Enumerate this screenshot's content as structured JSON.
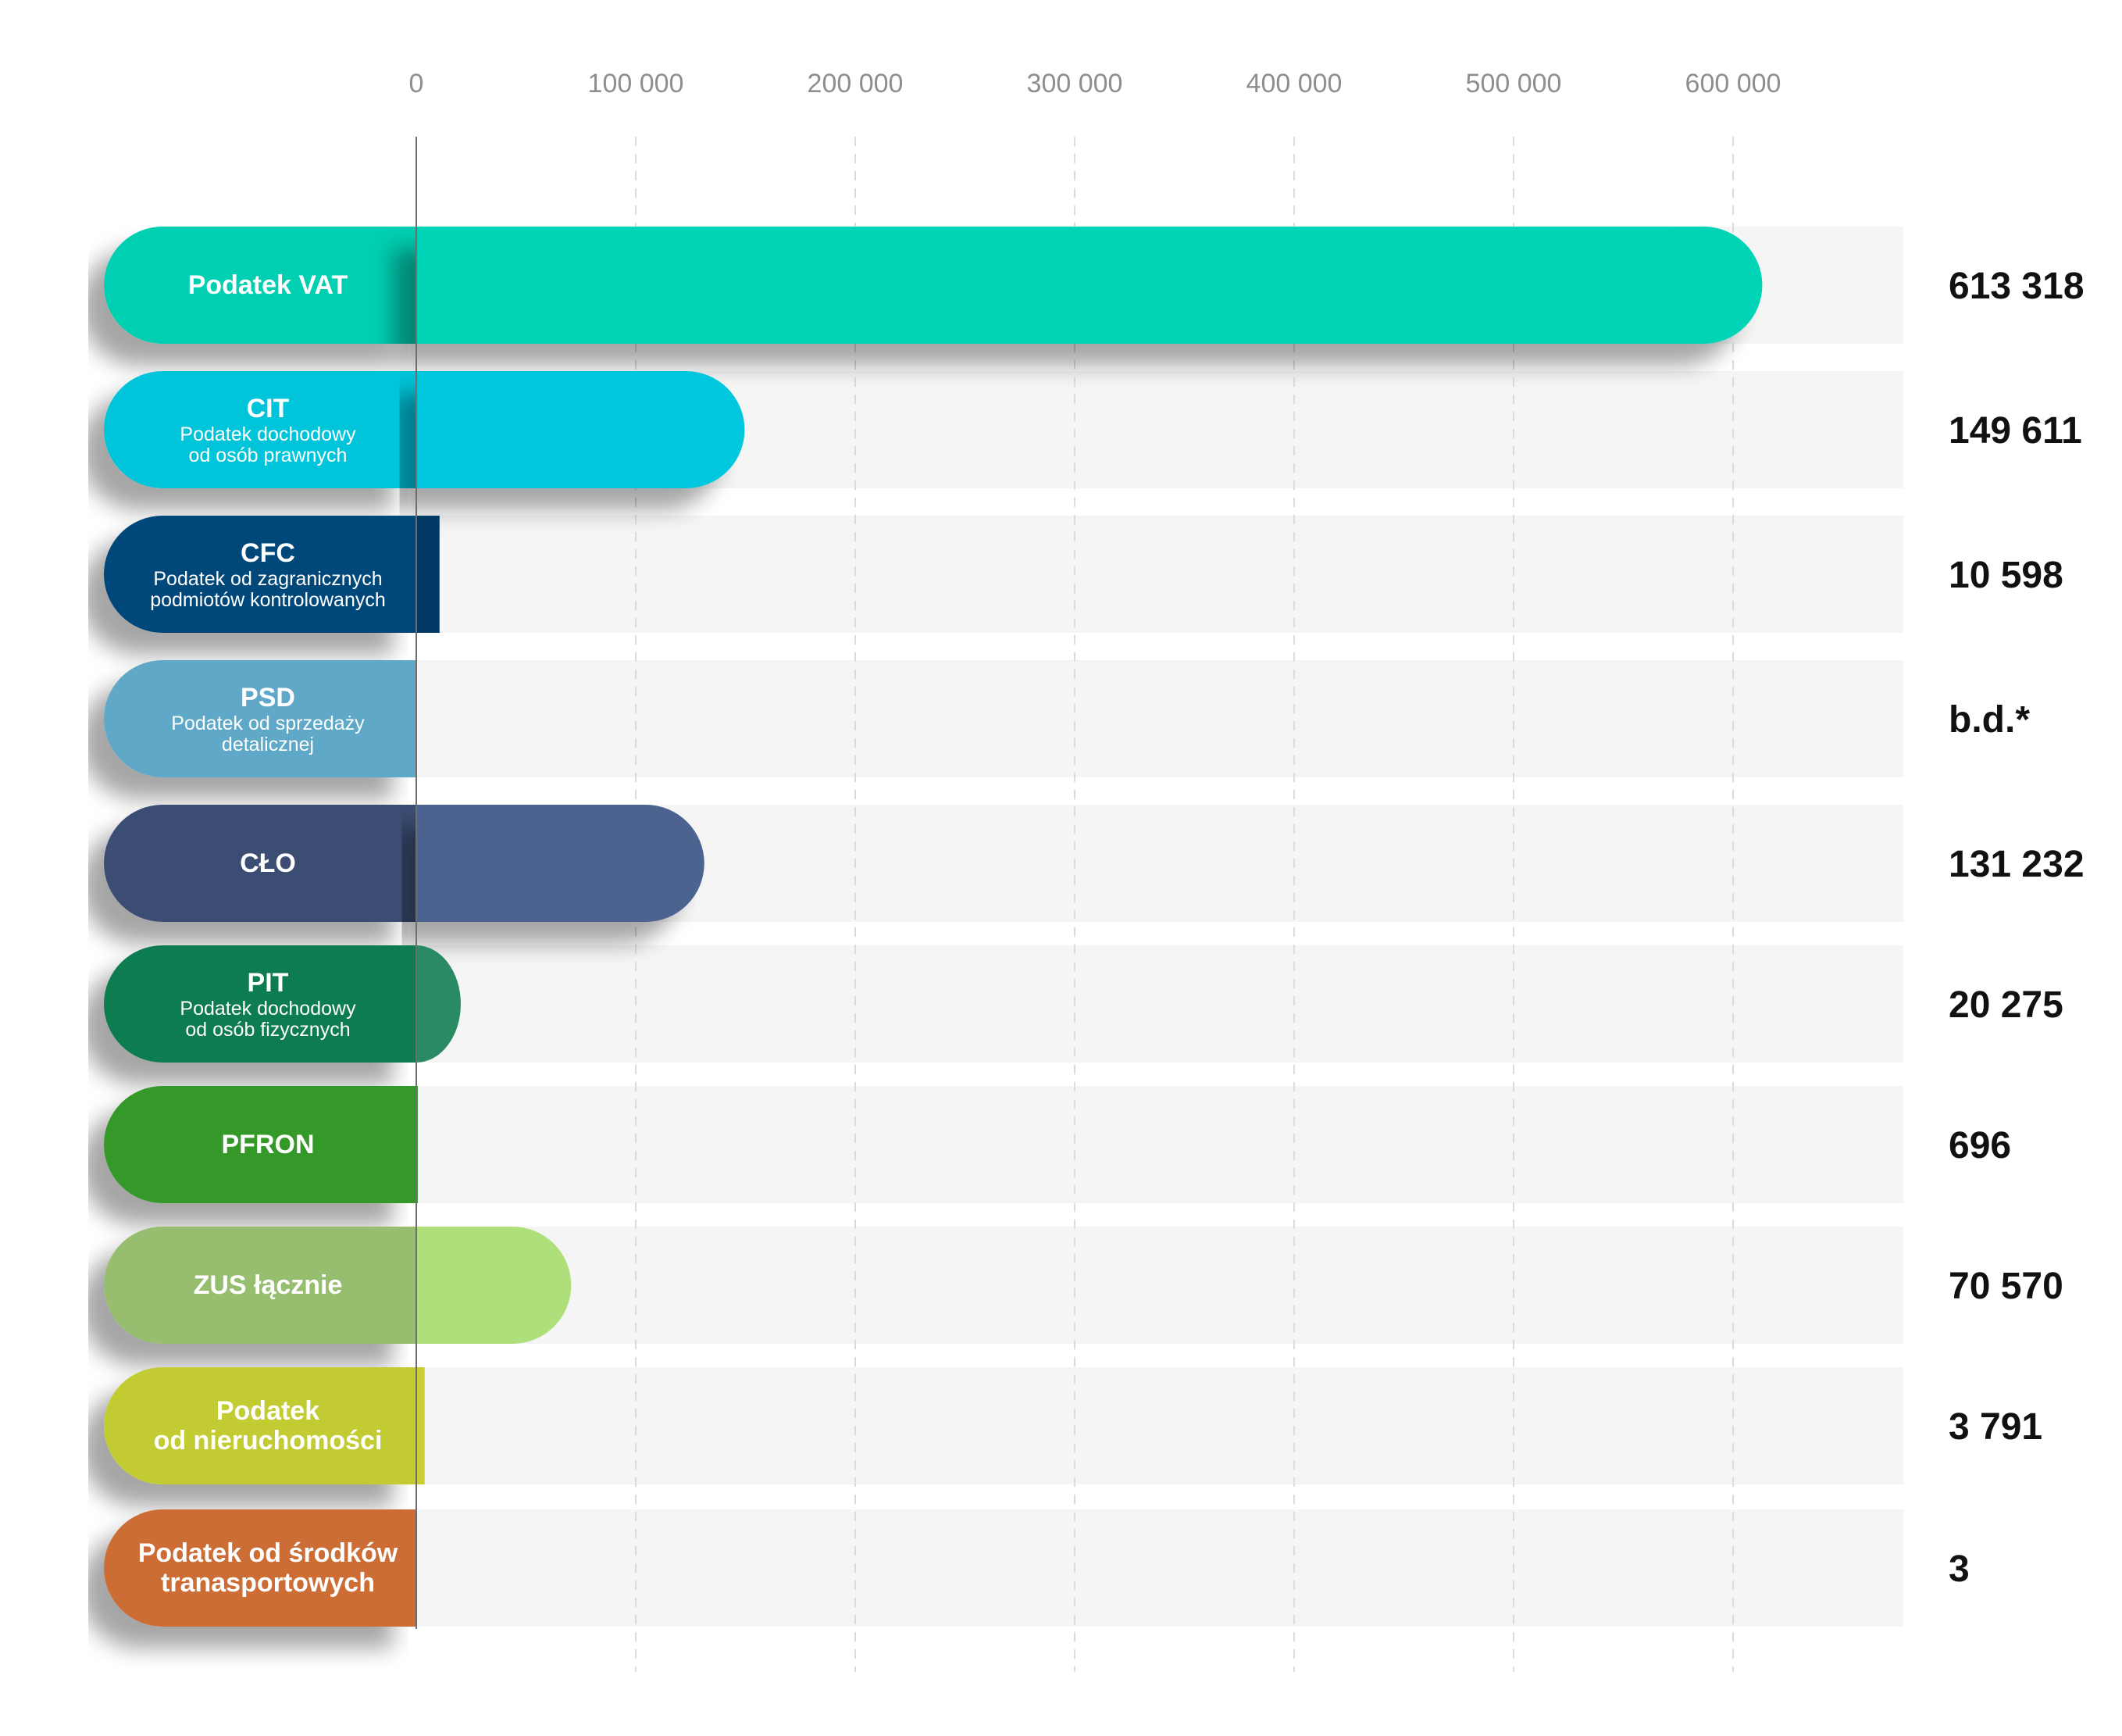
{
  "chart_data": {
    "type": "bar",
    "orientation": "horizontal",
    "xlim": [
      0,
      700000
    ],
    "x_ticks": [
      0,
      100000,
      200000,
      300000,
      400000,
      500000,
      600000
    ],
    "x_tick_labels": [
      "0",
      "100 000",
      "200 000",
      "300 000",
      "400 000",
      "500 000",
      "600 000"
    ],
    "grid": "vertical-dashed",
    "categories": [
      {
        "title": "Podatek VAT",
        "subtitle": [],
        "value": 613318,
        "value_label": "613 318",
        "color": "#00d4b6",
        "left_color": "#00cfb2"
      },
      {
        "title": "CIT",
        "subtitle": [
          "Podatek dochodowy",
          "od osób prawnych"
        ],
        "value": 149611,
        "value_label": "149 611",
        "color": "#00c7dd",
        "left_color": "#00c4da"
      },
      {
        "title": "CFC",
        "subtitle": [
          "Podatek od zagranicznych",
          "podmiotów kontrolowanych"
        ],
        "value": 10598,
        "value_label": "10 598",
        "color": "#023a66",
        "left_color": "#03467a"
      },
      {
        "title": "PSD",
        "subtitle": [
          "Podatek od sprzedaży",
          "detalicznej"
        ],
        "value": null,
        "value_label": "b.d.*",
        "color": "#5ea8c7",
        "left_color": "#5ea8c7"
      },
      {
        "title": "CŁO",
        "subtitle": [],
        "value": 131232,
        "value_label": "131 232",
        "color": "#4b638e",
        "left_color": "#3a4d73"
      },
      {
        "title": "PIT",
        "subtitle": [
          "Podatek dochodowy",
          "od osób fizycznych"
        ],
        "value": 20275,
        "value_label": "20 275",
        "color": "#2a8a64",
        "left_color": "#0b7c51"
      },
      {
        "title": "PFRON",
        "subtitle": [],
        "value": 696,
        "value_label": "696",
        "color": "#2e9a2c",
        "left_color": "#35992b"
      },
      {
        "title": "ZUS łącznie",
        "subtitle": [],
        "value": 70570,
        "value_label": "70 570",
        "color": "#afdf7b",
        "left_color": "#97bd6e"
      },
      {
        "title": "Podatek",
        "subtitle_bold": "od nieruchomości",
        "subtitle": [],
        "value": 3791,
        "value_label": "3 791",
        "color": "#c9cf33",
        "left_color": "#c2cc32"
      },
      {
        "title": "Podatek od środków",
        "subtitle_bold": "tranasportowych",
        "subtitle": [],
        "value": 3,
        "value_label": "3",
        "color": "#cc6d36",
        "left_color": "#cc6d36"
      }
    ]
  }
}
